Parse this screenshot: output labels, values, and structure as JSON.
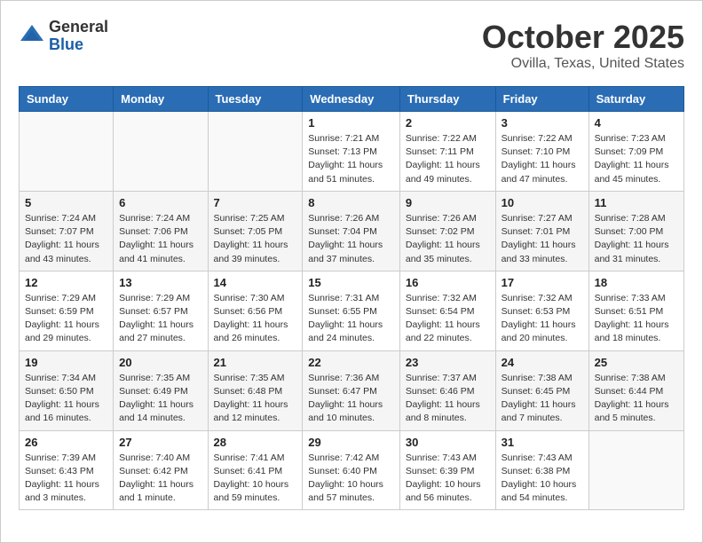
{
  "header": {
    "logo_general": "General",
    "logo_blue": "Blue",
    "month_title": "October 2025",
    "location": "Ovilla, Texas, United States"
  },
  "days_of_week": [
    "Sunday",
    "Monday",
    "Tuesday",
    "Wednesday",
    "Thursday",
    "Friday",
    "Saturday"
  ],
  "weeks": [
    [
      {
        "day": "",
        "info": ""
      },
      {
        "day": "",
        "info": ""
      },
      {
        "day": "",
        "info": ""
      },
      {
        "day": "1",
        "info": "Sunrise: 7:21 AM\nSunset: 7:13 PM\nDaylight: 11 hours\nand 51 minutes."
      },
      {
        "day": "2",
        "info": "Sunrise: 7:22 AM\nSunset: 7:11 PM\nDaylight: 11 hours\nand 49 minutes."
      },
      {
        "day": "3",
        "info": "Sunrise: 7:22 AM\nSunset: 7:10 PM\nDaylight: 11 hours\nand 47 minutes."
      },
      {
        "day": "4",
        "info": "Sunrise: 7:23 AM\nSunset: 7:09 PM\nDaylight: 11 hours\nand 45 minutes."
      }
    ],
    [
      {
        "day": "5",
        "info": "Sunrise: 7:24 AM\nSunset: 7:07 PM\nDaylight: 11 hours\nand 43 minutes."
      },
      {
        "day": "6",
        "info": "Sunrise: 7:24 AM\nSunset: 7:06 PM\nDaylight: 11 hours\nand 41 minutes."
      },
      {
        "day": "7",
        "info": "Sunrise: 7:25 AM\nSunset: 7:05 PM\nDaylight: 11 hours\nand 39 minutes."
      },
      {
        "day": "8",
        "info": "Sunrise: 7:26 AM\nSunset: 7:04 PM\nDaylight: 11 hours\nand 37 minutes."
      },
      {
        "day": "9",
        "info": "Sunrise: 7:26 AM\nSunset: 7:02 PM\nDaylight: 11 hours\nand 35 minutes."
      },
      {
        "day": "10",
        "info": "Sunrise: 7:27 AM\nSunset: 7:01 PM\nDaylight: 11 hours\nand 33 minutes."
      },
      {
        "day": "11",
        "info": "Sunrise: 7:28 AM\nSunset: 7:00 PM\nDaylight: 11 hours\nand 31 minutes."
      }
    ],
    [
      {
        "day": "12",
        "info": "Sunrise: 7:29 AM\nSunset: 6:59 PM\nDaylight: 11 hours\nand 29 minutes."
      },
      {
        "day": "13",
        "info": "Sunrise: 7:29 AM\nSunset: 6:57 PM\nDaylight: 11 hours\nand 27 minutes."
      },
      {
        "day": "14",
        "info": "Sunrise: 7:30 AM\nSunset: 6:56 PM\nDaylight: 11 hours\nand 26 minutes."
      },
      {
        "day": "15",
        "info": "Sunrise: 7:31 AM\nSunset: 6:55 PM\nDaylight: 11 hours\nand 24 minutes."
      },
      {
        "day": "16",
        "info": "Sunrise: 7:32 AM\nSunset: 6:54 PM\nDaylight: 11 hours\nand 22 minutes."
      },
      {
        "day": "17",
        "info": "Sunrise: 7:32 AM\nSunset: 6:53 PM\nDaylight: 11 hours\nand 20 minutes."
      },
      {
        "day": "18",
        "info": "Sunrise: 7:33 AM\nSunset: 6:51 PM\nDaylight: 11 hours\nand 18 minutes."
      }
    ],
    [
      {
        "day": "19",
        "info": "Sunrise: 7:34 AM\nSunset: 6:50 PM\nDaylight: 11 hours\nand 16 minutes."
      },
      {
        "day": "20",
        "info": "Sunrise: 7:35 AM\nSunset: 6:49 PM\nDaylight: 11 hours\nand 14 minutes."
      },
      {
        "day": "21",
        "info": "Sunrise: 7:35 AM\nSunset: 6:48 PM\nDaylight: 11 hours\nand 12 minutes."
      },
      {
        "day": "22",
        "info": "Sunrise: 7:36 AM\nSunset: 6:47 PM\nDaylight: 11 hours\nand 10 minutes."
      },
      {
        "day": "23",
        "info": "Sunrise: 7:37 AM\nSunset: 6:46 PM\nDaylight: 11 hours\nand 8 minutes."
      },
      {
        "day": "24",
        "info": "Sunrise: 7:38 AM\nSunset: 6:45 PM\nDaylight: 11 hours\nand 7 minutes."
      },
      {
        "day": "25",
        "info": "Sunrise: 7:38 AM\nSunset: 6:44 PM\nDaylight: 11 hours\nand 5 minutes."
      }
    ],
    [
      {
        "day": "26",
        "info": "Sunrise: 7:39 AM\nSunset: 6:43 PM\nDaylight: 11 hours\nand 3 minutes."
      },
      {
        "day": "27",
        "info": "Sunrise: 7:40 AM\nSunset: 6:42 PM\nDaylight: 11 hours\nand 1 minute."
      },
      {
        "day": "28",
        "info": "Sunrise: 7:41 AM\nSunset: 6:41 PM\nDaylight: 10 hours\nand 59 minutes."
      },
      {
        "day": "29",
        "info": "Sunrise: 7:42 AM\nSunset: 6:40 PM\nDaylight: 10 hours\nand 57 minutes."
      },
      {
        "day": "30",
        "info": "Sunrise: 7:43 AM\nSunset: 6:39 PM\nDaylight: 10 hours\nand 56 minutes."
      },
      {
        "day": "31",
        "info": "Sunrise: 7:43 AM\nSunset: 6:38 PM\nDaylight: 10 hours\nand 54 minutes."
      },
      {
        "day": "",
        "info": ""
      }
    ]
  ]
}
